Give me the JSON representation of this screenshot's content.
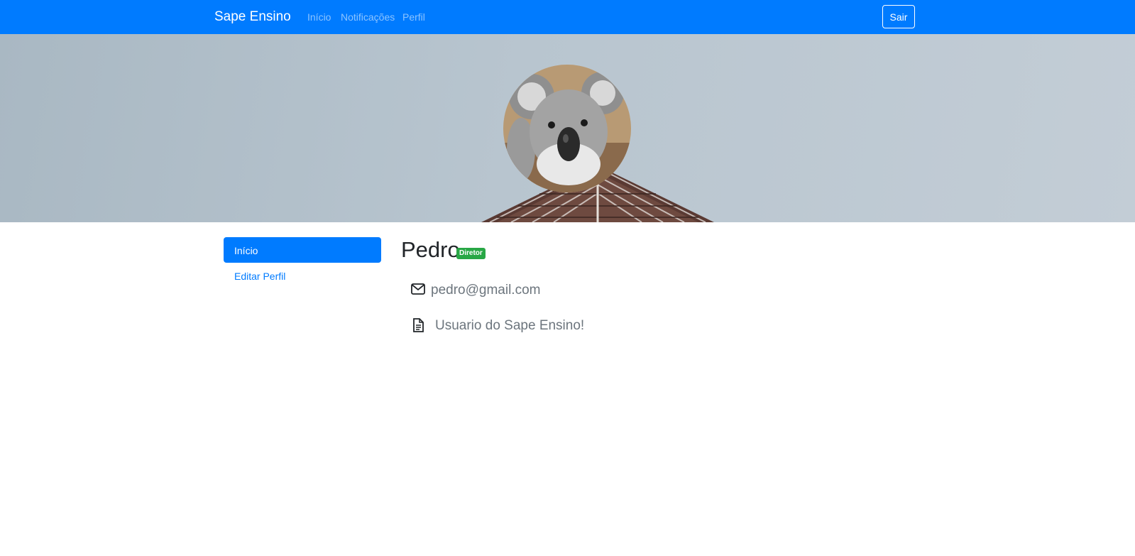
{
  "navbar": {
    "brand": "Sape Ensino",
    "links": [
      "Início",
      "Notificações",
      "Perfil"
    ],
    "logout_label": "Sair"
  },
  "sidebar": {
    "items": [
      {
        "label": "Início",
        "active": true
      },
      {
        "label": "Editar Perfil",
        "active": false
      }
    ]
  },
  "profile": {
    "name": "Pedro",
    "role_badge": "Diretor",
    "email": "pedro@gmail.com",
    "bio": "Usuario do Sape Ensino!",
    "email_icon": "envelope-icon",
    "bio_icon": "document-icon",
    "avatar_subject": "koala"
  },
  "colors": {
    "primary": "#007bff",
    "badge": "#28a745",
    "muted_text": "#6c757d"
  }
}
